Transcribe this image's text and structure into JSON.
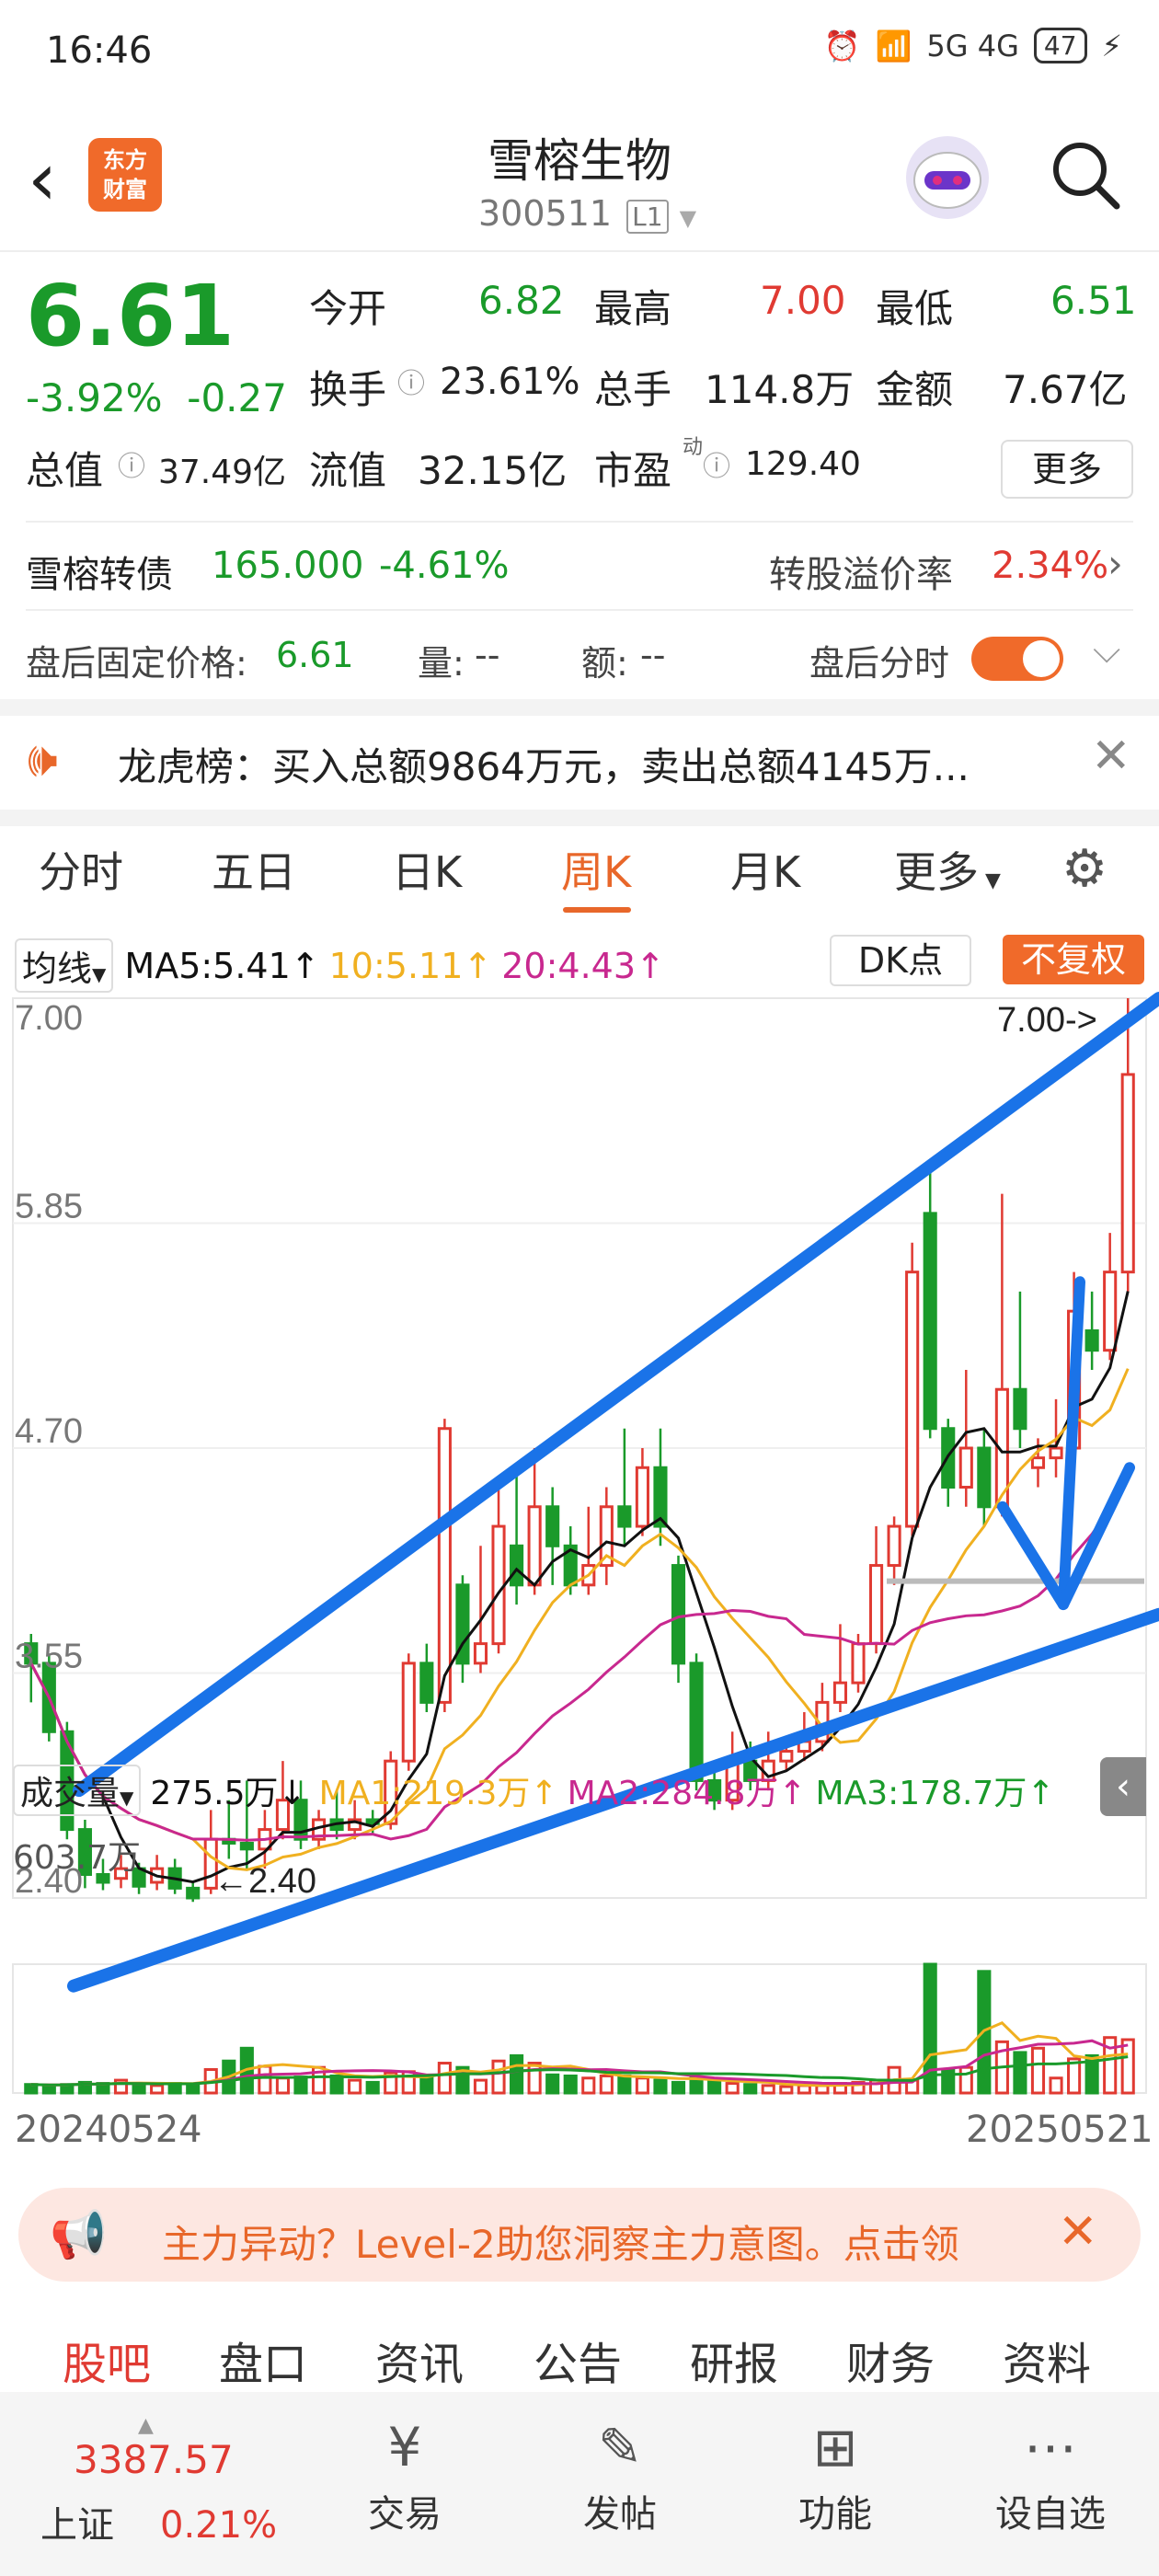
{
  "status_bar": {
    "time": "16:46",
    "network": "5G 4G",
    "battery": "47"
  },
  "header": {
    "title": "雪榕生物",
    "code": "300511",
    "level": "L1",
    "logo_text_1": "东方",
    "logo_text_2": "财富"
  },
  "quote": {
    "price": "6.61",
    "change_pct": "-3.92%",
    "change": "-0.27",
    "open_label": "今开",
    "open": "6.82",
    "high_label": "最高",
    "high": "7.00",
    "low_label": "最低",
    "low": "6.51",
    "turnover_label": "换手",
    "turnover": "23.61%",
    "volume_label": "总手",
    "volume": "114.8万",
    "amount_label": "金额",
    "amount": "7.67亿",
    "mktcap_label": "总值",
    "mktcap": "37.49亿",
    "float_label": "流值",
    "float": "32.15亿",
    "pe_label": "市盈",
    "pe_sup": "动",
    "pe": "129.40",
    "more": "更多"
  },
  "bond": {
    "name": "雪榕转债",
    "price": "165.000",
    "chg": "-4.61%",
    "premium_label": "转股溢价率",
    "premium": "2.34%"
  },
  "after_hours": {
    "label": "盘后固定价格:",
    "price": "6.61",
    "vol_label": "量:",
    "vol": "--",
    "amt_label": "额:",
    "amt": "--",
    "toggle_label": "盘后分时"
  },
  "notice": {
    "text": "龙虎榜：买入总额9864万元，卖出总额4145万..."
  },
  "tabs": [
    "分时",
    "五日",
    "日K",
    "周K",
    "月K",
    "更多"
  ],
  "active_tab": "周K",
  "ma_legend": {
    "label": "均线",
    "ma5": "MA5:5.41↑",
    "ma10": "10:5.11↑",
    "ma20": "20:4.43↑",
    "dk": "DK点",
    "fq": "不复权"
  },
  "vol_legend": {
    "label": "成交量",
    "value": "275.5万↓",
    "ma1": "MA1:219.3万↑",
    "ma2": "MA2:284.8万↑",
    "ma3": "MA3:178.7万↑",
    "max": "603.7万"
  },
  "colors": {
    "up": "#e03a32",
    "down": "#1a9a2a",
    "ma5": "#111111",
    "ma10": "#f0b020",
    "ma20": "#c8288f",
    "trend": "#1a73e8",
    "accent": "#f06a2a"
  },
  "chart_data": {
    "type": "candlestick",
    "price_axis": {
      "ticks": [
        "7.00",
        "5.85",
        "4.70",
        "3.55",
        "2.40"
      ],
      "ylim": [
        2.4,
        7.0
      ]
    },
    "high_label": "7.00->",
    "low_label": "2.40",
    "x_start": "20240524",
    "x_end": "20250521",
    "candles": [
      [
        3.7,
        3.6,
        3.75,
        3.4
      ],
      [
        3.6,
        3.25,
        3.65,
        3.2
      ],
      [
        3.25,
        2.75,
        3.3,
        2.7
      ],
      [
        2.75,
        2.52,
        2.8,
        2.45
      ],
      [
        2.52,
        2.48,
        2.6,
        2.44
      ],
      [
        2.5,
        2.55,
        2.62,
        2.45
      ],
      [
        2.55,
        2.46,
        2.58,
        2.42
      ],
      [
        2.48,
        2.55,
        2.62,
        2.44
      ],
      [
        2.55,
        2.45,
        2.6,
        2.42
      ],
      [
        2.45,
        2.4,
        2.48,
        2.38
      ],
      [
        2.45,
        2.7,
        2.85,
        2.42
      ],
      [
        2.7,
        2.68,
        2.9,
        2.6
      ],
      [
        2.68,
        2.65,
        3.0,
        2.55
      ],
      [
        2.65,
        2.75,
        2.85,
        2.55
      ],
      [
        2.75,
        2.9,
        3.1,
        2.7
      ],
      [
        2.9,
        2.7,
        3.0,
        2.65
      ],
      [
        2.7,
        2.8,
        2.85,
        2.65
      ],
      [
        2.8,
        2.75,
        2.95,
        2.7
      ],
      [
        2.75,
        2.8,
        2.9,
        2.7
      ],
      [
        2.8,
        2.78,
        2.85,
        2.72
      ],
      [
        2.78,
        3.1,
        3.15,
        2.75
      ],
      [
        3.1,
        3.6,
        3.65,
        3.05
      ],
      [
        3.6,
        3.4,
        3.7,
        3.35
      ],
      [
        3.4,
        4.8,
        4.85,
        3.35
      ],
      [
        4.0,
        3.6,
        4.05,
        3.5
      ],
      [
        3.6,
        3.7,
        4.2,
        3.55
      ],
      [
        3.7,
        4.3,
        4.5,
        3.65
      ],
      [
        4.2,
        4.0,
        4.6,
        3.9
      ],
      [
        4.0,
        4.4,
        4.7,
        3.95
      ],
      [
        4.4,
        4.2,
        4.5,
        4.0
      ],
      [
        4.2,
        4.0,
        4.3,
        3.95
      ],
      [
        4.0,
        4.1,
        4.4,
        3.95
      ],
      [
        4.1,
        4.4,
        4.5,
        4.0
      ],
      [
        4.4,
        4.3,
        4.8,
        4.2
      ],
      [
        4.3,
        4.6,
        4.7,
        4.25
      ],
      [
        4.6,
        4.3,
        4.8,
        4.2
      ],
      [
        4.1,
        3.6,
        4.15,
        3.5
      ],
      [
        3.6,
        3.0,
        3.65,
        2.95
      ],
      [
        3.0,
        2.9,
        3.1,
        2.85
      ],
      [
        2.9,
        3.1,
        3.25,
        2.85
      ],
      [
        3.1,
        3.0,
        3.2,
        2.95
      ],
      [
        3.0,
        3.1,
        3.25,
        2.95
      ],
      [
        3.1,
        3.15,
        3.2,
        3.05
      ],
      [
        3.15,
        3.2,
        3.35,
        3.1
      ],
      [
        3.2,
        3.4,
        3.5,
        3.15
      ],
      [
        3.4,
        3.5,
        3.8,
        3.35
      ],
      [
        3.5,
        3.7,
        3.75,
        3.45
      ],
      [
        3.7,
        4.1,
        4.3,
        3.65
      ],
      [
        4.1,
        4.3,
        4.35,
        4.0
      ],
      [
        4.3,
        5.6,
        5.75,
        4.25
      ],
      [
        5.9,
        4.8,
        6.15,
        4.75
      ],
      [
        4.8,
        4.5,
        4.85,
        4.4
      ],
      [
        4.5,
        4.7,
        5.1,
        4.4
      ],
      [
        4.7,
        4.4,
        4.8,
        4.3
      ],
      [
        4.4,
        5.0,
        6.0,
        4.35
      ],
      [
        5.0,
        4.8,
        5.5,
        4.7
      ],
      [
        4.6,
        4.65,
        4.75,
        4.5
      ],
      [
        4.65,
        4.7,
        4.95,
        4.55
      ],
      [
        4.7,
        5.4,
        5.6,
        4.65
      ],
      [
        5.3,
        5.2,
        5.5,
        5.1
      ],
      [
        5.2,
        5.6,
        5.8,
        5.15
      ],
      [
        5.6,
        6.61,
        7.0,
        5.5
      ]
    ],
    "volume_ylim": [
      0,
      603.7
    ],
    "volumes": [
      40,
      35,
      40,
      50,
      45,
      60,
      40,
      35,
      45,
      40,
      110,
      150,
      210,
      125,
      70,
      75,
      120,
      80,
      60,
      50,
      95,
      100,
      70,
      140,
      120,
      60,
      150,
      175,
      140,
      85,
      80,
      70,
      80,
      80,
      70,
      60,
      50,
      75,
      55,
      45,
      40,
      35,
      30,
      35,
      35,
      45,
      50,
      60,
      120,
      60,
      603.7,
      110,
      120,
      570,
      240,
      190,
      210,
      70,
      160,
      175,
      260,
      250
    ]
  },
  "banner": {
    "text": "主力异动？Level-2助您洞察主力意图。点击领"
  },
  "bottom_tabs": [
    "股吧",
    "盘口",
    "资讯",
    "公告",
    "研报",
    "财务",
    "资料"
  ],
  "active_bottom_tab": "股吧",
  "index": {
    "value": "3387.57",
    "name": "上证",
    "chg": "0.21%"
  },
  "bottom_nav": [
    {
      "label": "交易",
      "icon": "trade-icon"
    },
    {
      "label": "发帖",
      "icon": "post-icon"
    },
    {
      "label": "功能",
      "icon": "apps-icon"
    },
    {
      "label": "设自选",
      "icon": "watchlist-icon"
    }
  ]
}
